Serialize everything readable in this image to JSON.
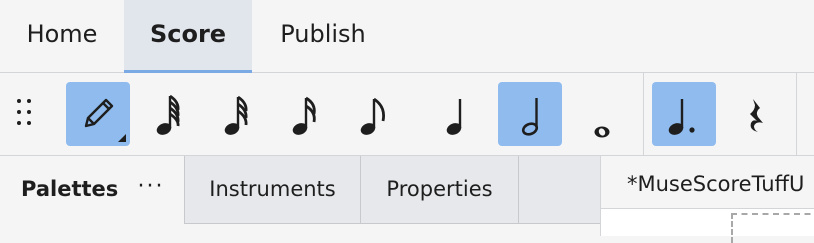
{
  "menu_tabs": [
    {
      "label": "Home"
    },
    {
      "label": "Score"
    },
    {
      "label": "Publish"
    }
  ],
  "toolbar": {
    "buttons": [
      {
        "icon": "pencil-icon",
        "active": true
      },
      {
        "icon": "64th-note-icon",
        "active": false
      },
      {
        "icon": "32nd-note-icon",
        "active": false
      },
      {
        "icon": "16th-note-icon",
        "active": false
      },
      {
        "icon": "eighth-note-icon",
        "active": false
      },
      {
        "icon": "quarter-note-icon",
        "active": false
      },
      {
        "icon": "half-note-icon",
        "active": true
      },
      {
        "icon": "whole-note-icon",
        "active": false
      },
      {
        "icon": "augmentation-dot-icon",
        "active": true
      },
      {
        "icon": "rest-icon",
        "active": false
      }
    ],
    "active_color": "#8fbbee"
  },
  "panels": {
    "palettes_label": "Palettes",
    "menu_label": "···",
    "instruments_label": "Instruments",
    "properties_label": "Properties"
  },
  "document": {
    "tab_label": "*MuseScoreTuffU"
  },
  "colors": {
    "accent": "#7aa9e3",
    "selected_tab_bg": "#e1e6ed",
    "background": "#f5f5f6"
  }
}
